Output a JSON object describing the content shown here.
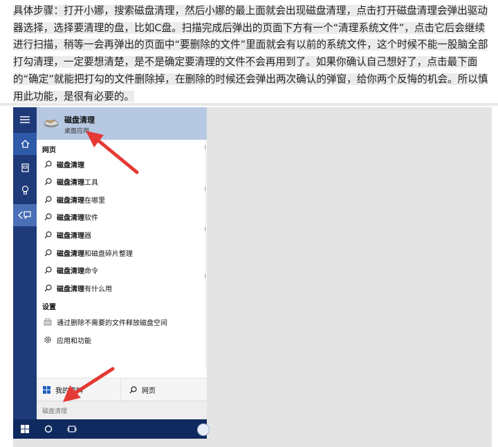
{
  "article": {
    "paragraph": "具体步骤：打开小娜，搜索磁盘清理，然后小娜的最上面就会出现磁盘清理，点击打开磁盘清理会弹出驱动器选择，选择要清理的盘，比如C盘。扫描完成后弹出的页面下方有一个“清理系统文件”，点击它后会继续进行扫描，稍等一会再弹出的页面中“要删除的文件”里面就会有以前的系统文件，这个时候不能一股脑全部打勾清理，一定要想清楚，是不是确定要清理的文件不会再用到了。如果你确认自己想好了，点击最下面的“确定”就能把打勾的文件删除掉，在删除的时候还会弹出两次确认的弹窗，给你两个反悔的机会。所以慎用此功能，是很有必要的。"
  },
  "start_menu": {
    "rail_icons": [
      "hamburger-icon",
      "home-icon",
      "notebook-icon",
      "lightbulb-icon",
      "feedback-icon"
    ],
    "best_match": {
      "title": "磁盘清理",
      "subtitle": "桌面应用",
      "icon": "disk-cleanup-icon"
    },
    "web_section_label": "网页",
    "web_results": [
      {
        "bold": "磁盘清理",
        "rest": ""
      },
      {
        "bold": "磁盘清理",
        "rest": "工具"
      },
      {
        "bold": "磁盘清理",
        "rest": "在哪里"
      },
      {
        "bold": "磁盘清理",
        "rest": "软件"
      },
      {
        "bold": "磁盘清理",
        "rest": "器"
      },
      {
        "bold": "磁盘清理",
        "rest": "和磁盘碎片整理"
      },
      {
        "bold": "磁盘清理",
        "rest": "命令"
      },
      {
        "bold": "磁盘清理",
        "rest": "有什么用"
      }
    ],
    "settings_section_label": "设置",
    "settings_results": [
      {
        "label": "通过删除不需要的文件释放磁盘空间",
        "icon": "cleanup-settings-icon"
      },
      {
        "label": "应用和功能",
        "icon": "gear-icon"
      }
    ],
    "bottom_tabs": {
      "left": "我的资料",
      "right": "网页"
    },
    "search_value": "磁盘清理"
  },
  "colors": {
    "rail": "#1e3a78",
    "best_match_bg": "#b6c8e2",
    "taskbar": "#0f2a5e",
    "arrow": "#e53935"
  }
}
